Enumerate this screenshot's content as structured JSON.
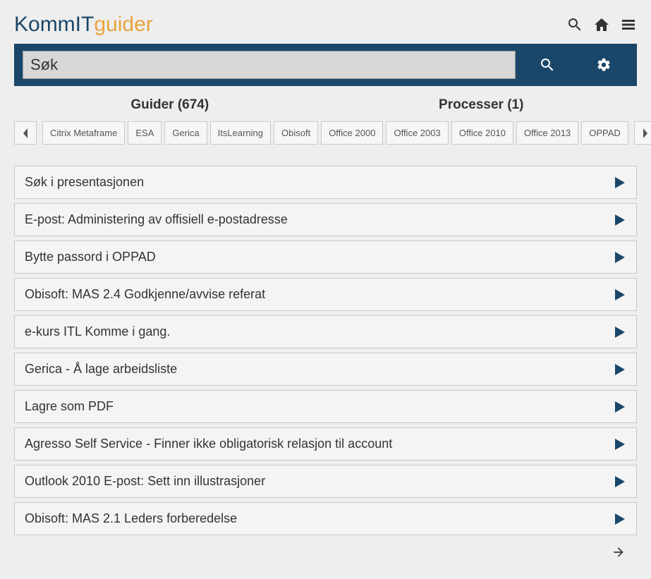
{
  "logo": {
    "part1": "KommIT",
    "part2": "guider"
  },
  "search": {
    "placeholder": "Søk"
  },
  "tabs": {
    "guides": "Guider (674)",
    "processes": "Processer (1)"
  },
  "filters": [
    "Citrix Metaframe",
    "ESA",
    "Gerica",
    "ItsLearning",
    "Obisoft",
    "Office 2000",
    "Office 2003",
    "Office 2010",
    "Office 2013",
    "OPPAD"
  ],
  "guides": [
    "Søk i presentasjonen",
    "E-post: Administering av offisiell e-postadresse",
    "Bytte passord i OPPAD",
    "Obisoft: MAS 2.4 Godkjenne/avvise referat",
    "e-kurs ITL Komme i gang.",
    "Gerica - Å lage arbeidsliste",
    "Lagre som PDF",
    "Agresso Self Service - Finner ikke obligatorisk relasjon til account",
    "Outlook 2010 E-post: Sett inn illustrasjoner",
    "Obisoft: MAS 2.1 Leders forberedelse"
  ],
  "colors": {
    "primary": "#1a4769",
    "accent": "#e8a33d"
  }
}
